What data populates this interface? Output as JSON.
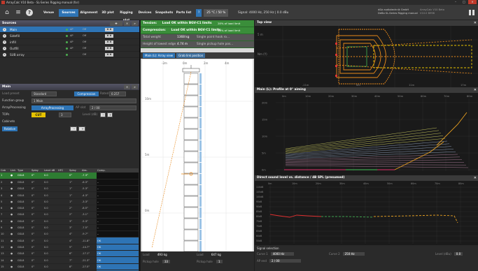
{
  "window": {
    "title": "ArrayCalc V10 Beta - SL-Series Rigging manual (for)"
  },
  "toolbar": {
    "tabs": [
      {
        "label": "Venue",
        "active": false
      },
      {
        "label": "Sources",
        "active": true
      },
      {
        "label": "Alignment",
        "active": false
      },
      {
        "label": "3D plot",
        "active": false
      },
      {
        "label": "Rigging plot",
        "active": false
      },
      {
        "label": "Devices",
        "active": false
      },
      {
        "label": "Snapshots",
        "active": false
      },
      {
        "label": "Parts list",
        "active": false
      }
    ],
    "temp_button": "?",
    "temp_value": "25 °C / 50 %",
    "signal": "Signal: 4000 Hz, 250 Hz | 0.0 dBu",
    "license_line1": "d&b audiotechnik GmbH",
    "license_line2": "DeBa SL-Series Rigging manual",
    "license_right1": "ArrayCalc V10 Beta",
    "license_right2": "V10.0 B998"
  },
  "sources": {
    "title": "Sources",
    "items": [
      {
        "num": "1",
        "name": "Main",
        "ap": "AP",
        "grp": "Off",
        "selected": true
      },
      {
        "num": "2",
        "name": "Sidefill",
        "ap": "AP",
        "grp": "Off",
        "selected": false
      },
      {
        "num": "3",
        "name": "infill",
        "ap": "AP",
        "grp": "Off",
        "selected": false
      },
      {
        "num": "4",
        "name": "Outfill",
        "ap": "AP",
        "grp": "Off",
        "selected": false
      },
      {
        "num": "5",
        "name": "SUB array",
        "ap": "",
        "grp": "Off",
        "selected": false
      }
    ]
  },
  "main": {
    "title": "Main",
    "load_preset": "Load preset",
    "standard": "Standard",
    "compression": "Compression",
    "rated": "Rated",
    "rated_val": "0.257",
    "function_group_label": "Function group",
    "function_group": "1 Main",
    "arrayprocessing_label": "ArrayProcessing",
    "arrayprocessing_btn": "ArrayProcessing",
    "ap_slot": "AP slot",
    "ap_slot_val": "2 / 00",
    "tops_label": "TOPs",
    "cut_btn": "CUT",
    "tops_num": "3",
    "level_label": "Level (dB)",
    "cabinets_label": "Cabinets",
    "relative_btn": "Relative",
    "cab_headers": [
      "Cab",
      "Link",
      "Type",
      "Splay",
      "Level dB",
      "HFC",
      "Splay",
      "Abs.",
      "Comp."
    ],
    "cabinets": [
      {
        "n": "1",
        "type": "GSL8",
        "splay": "0°",
        "lvl": "0.0",
        "hfc": "",
        "sp": "0°",
        "abs": "-7.3°",
        "comp": "",
        "sel": true
      },
      {
        "n": "2",
        "type": "GSL8",
        "splay": "0°",
        "lvl": "0.0",
        "hfc": "",
        "sp": "1°",
        "abs": "-6.3°",
        "comp": "–"
      },
      {
        "n": "3",
        "type": "GSL8",
        "splay": "0°",
        "lvl": "0.0",
        "hfc": "",
        "sp": "1°",
        "abs": "-5.3°",
        "comp": "–"
      },
      {
        "n": "4",
        "type": "GSL8",
        "splay": "0°",
        "lvl": "0.0",
        "hfc": "",
        "sp": "1°",
        "abs": "-4.3°",
        "comp": "–"
      },
      {
        "n": "5",
        "type": "GSL8",
        "splay": "0°",
        "lvl": "0.0",
        "hfc": "",
        "sp": "1°",
        "abs": "-3.3°",
        "comp": "–"
      },
      {
        "n": "6",
        "type": "GSL8",
        "splay": "0°",
        "lvl": "0.0",
        "hfc": "",
        "sp": "2°",
        "abs": "-8.5°",
        "comp": "–"
      },
      {
        "n": "7",
        "type": "GSL8",
        "splay": "0°",
        "lvl": "0.0",
        "hfc": "",
        "sp": "2°",
        "abs": "-3.1°",
        "comp": "–"
      },
      {
        "n": "8",
        "type": "GSL8",
        "splay": "0°",
        "lvl": "0.0",
        "hfc": "",
        "sp": "3°",
        "abs": "-5.3°",
        "comp": "–"
      },
      {
        "n": "9",
        "type": "GSL8",
        "splay": "0°",
        "lvl": "0.0",
        "hfc": "",
        "sp": "3°",
        "abs": "-7.5°",
        "comp": "–"
      },
      {
        "n": "10",
        "type": "GSL8",
        "splay": "0°",
        "lvl": "0.0",
        "hfc": "",
        "sp": "4°",
        "abs": "-9.7°",
        "comp": "–"
      },
      {
        "n": "11",
        "type": "GSL8",
        "splay": "0°",
        "lvl": "0.0",
        "hfc": "",
        "sp": "4°",
        "abs": "-11.8°",
        "comp": "OK"
      },
      {
        "n": "12",
        "type": "GSL8",
        "splay": "0°",
        "lvl": "0.0",
        "hfc": "",
        "sp": "5°",
        "abs": "-14.7°",
        "comp": "OK"
      },
      {
        "n": "13",
        "type": "GSL8",
        "splay": "0°",
        "lvl": "0.0",
        "hfc": "",
        "sp": "6°",
        "abs": "-17.1°",
        "comp": "OK"
      },
      {
        "n": "14",
        "type": "GSL8",
        "splay": "0°",
        "lvl": "0.0",
        "hfc": "",
        "sp": "7°",
        "abs": "-21.3°",
        "comp": "OK"
      },
      {
        "n": "15",
        "type": "GSL8",
        "splay": "0°",
        "lvl": "0.0",
        "hfc": "",
        "sp": "8°",
        "abs": "-27.5°",
        "comp": "OK"
      },
      {
        "n": "16",
        "type": "GSL8",
        "splay": "0°",
        "lvl": "0.0",
        "hfc": "",
        "sp": "9°",
        "abs": "-34.5°",
        "comp": "OK"
      }
    ]
  },
  "status": {
    "tension_label": "Tension:",
    "tension_val": "Load OK within BGV-C1 limits",
    "tension_pct": "28% of load limit",
    "comp_label": "Compression:",
    "comp_val": "Load OK within BGV-C1 limits",
    "comp_pct": "34% of load limit",
    "totalweight": "Total weight",
    "totalweight_val": "1368 kg",
    "totalweight_note": "Single point hook ro...",
    "height_label": "Height of lowest edge",
    "height_val": "4.74 m",
    "height_note": "Single pickup hole pos..."
  },
  "rig": {
    "tab1": "Main (L): Array view",
    "tab2": "Grab link position",
    "top_ticks": [
      "-2m",
      "0m",
      "2m",
      "4m"
    ],
    "left_ticks": [
      "10m",
      "5m",
      "0m"
    ],
    "legend1": "Center of gravity",
    "legend2": "Pickpoints",
    "legend3": "Grab link: Bottom (ref. 1)"
  },
  "rear": {
    "rear_pos": "Rear pos",
    "front_pos": "Front pos",
    "load_label1": "Load",
    "load_val1": "493 kg",
    "load_label2": "Load",
    "load_val2": "647 kg",
    "pickup1": "Pickup hole",
    "pickup1_val": "33",
    "pickup2": "Pickup hole",
    "pickup2_val": "1"
  },
  "topview": {
    "title": "Top view",
    "label_5m": "5 m",
    "label_y": "Nm (Y)",
    "bottom_ticks": [
      "-11m",
      "0m",
      "11m",
      "17m"
    ]
  },
  "profile": {
    "title": "Main (L): Profile at 0° aiming",
    "x_ticks": [
      "0m",
      "10m",
      "20m",
      "30m",
      "40m",
      "50m",
      "60m",
      "70m",
      "80m"
    ],
    "y_ticks": [
      "20m",
      "15m",
      "10m",
      "5m",
      "0m"
    ]
  },
  "dsl": {
    "title": "Direct sound level vs. distance / 4B SPL (presumed)",
    "y_ticks": [
      "110dB",
      "105dB",
      "100dB",
      "95dB",
      "90dB",
      "85dB",
      "80dB",
      "75dB",
      "70dB",
      "65dB",
      "60dB",
      "55dB"
    ],
    "x_ticks": [
      "0m",
      "10m",
      "20m",
      "30m",
      "40m",
      "50m",
      "60m",
      "70m",
      "80m"
    ]
  },
  "signal": {
    "title": "Signal selection",
    "curve1": "Curve 1",
    "curve1_val": "4000 Hz",
    "curve2": "Curve 2",
    "curve2_val": "250 Hz",
    "ap_end": "AP end",
    "ap_end_val": "2 / 00",
    "level": "Level (dBu)",
    "level_val": "0.0"
  },
  "colors": {
    "accent": "#2e74b5",
    "ok_green": "#3a8e3a",
    "warn": "#e6c200"
  }
}
